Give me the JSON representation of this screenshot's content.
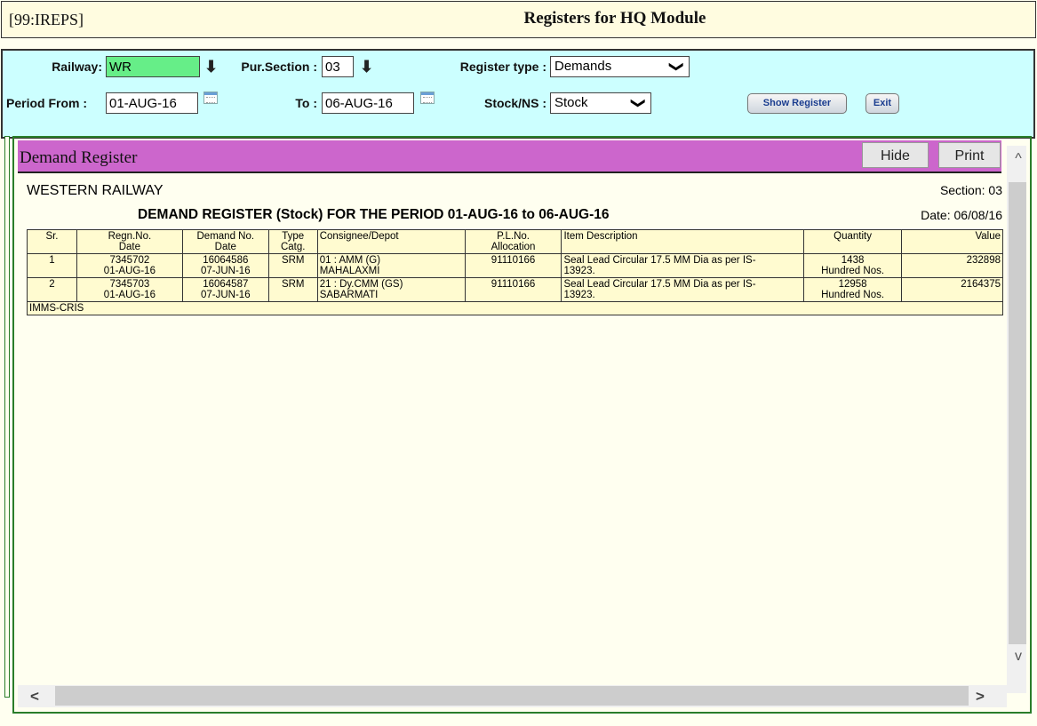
{
  "header": {
    "tag": "[99:IREPS]",
    "title": "Registers for HQ Module"
  },
  "filters": {
    "railway_label": "Railway:",
    "railway_value": "WR",
    "pur_section_label": "Pur.Section :",
    "pur_section_value": "03",
    "register_type_label": "Register type :",
    "register_type_value": "Demands",
    "period_from_label": "Period From :",
    "period_from_value": "01-AUG-16",
    "to_label": "To :",
    "to_value": "06-AUG-16",
    "stock_ns_label": "Stock/NS :",
    "stock_ns_value": "Stock",
    "show_register_label": "Show Register",
    "exit_label": "Exit",
    "download_glyph": "⬇",
    "chevron_glyph": "❯"
  },
  "panel": {
    "title": "Demand Register",
    "hide_label": "Hide",
    "print_label": "Print"
  },
  "report": {
    "railway": "WESTERN RAILWAY",
    "section": "Section: 03",
    "title": "DEMAND REGISTER (Stock) FOR THE PERIOD 01-AUG-16 to 06-AUG-16",
    "date": "Date: 06/08/16",
    "footer": "IMMS-CRIS",
    "columns": [
      {
        "l1": "Sr.",
        "l2": ""
      },
      {
        "l1": "Regn.No.",
        "l2": "Date"
      },
      {
        "l1": "Demand No.",
        "l2": "Date"
      },
      {
        "l1": "Type",
        "l2": "Catg."
      },
      {
        "l1": "Consignee/Depot",
        "l2": ""
      },
      {
        "l1": "P.L.No.",
        "l2": "Allocation"
      },
      {
        "l1": "Item Description",
        "l2": ""
      },
      {
        "l1": "Quantity",
        "l2": ""
      },
      {
        "l1": "Value",
        "l2": ""
      }
    ],
    "rows": [
      {
        "sr": "1",
        "regn_no": "7345702",
        "regn_date": "01-AUG-16",
        "demand_no": "16064586",
        "demand_date": "07-JUN-16",
        "type": "SRM",
        "consignee_l1": "01 : AMM (G)",
        "consignee_l2": "MAHALAXMI",
        "pl_no": "91110166",
        "item_l1": "Seal Lead Circular 17.5 MM Dia as per IS-",
        "item_l2": "13923.",
        "qty": "1438",
        "unit": "Hundred Nos.",
        "value": "232898"
      },
      {
        "sr": "2",
        "regn_no": "7345703",
        "regn_date": "01-AUG-16",
        "demand_no": "16064587",
        "demand_date": "07-JUN-16",
        "type": "SRM",
        "consignee_l1": "21 : Dy.CMM (GS)",
        "consignee_l2": "SABARMATI",
        "pl_no": "91110166",
        "item_l1": "Seal Lead Circular 17.5 MM Dia as per IS-",
        "item_l2": "13923.",
        "qty": "12958",
        "unit": "Hundred Nos.",
        "value": "2164375"
      }
    ]
  },
  "scroll": {
    "up": "^",
    "down": "v",
    "left": "<",
    "right": ">"
  }
}
